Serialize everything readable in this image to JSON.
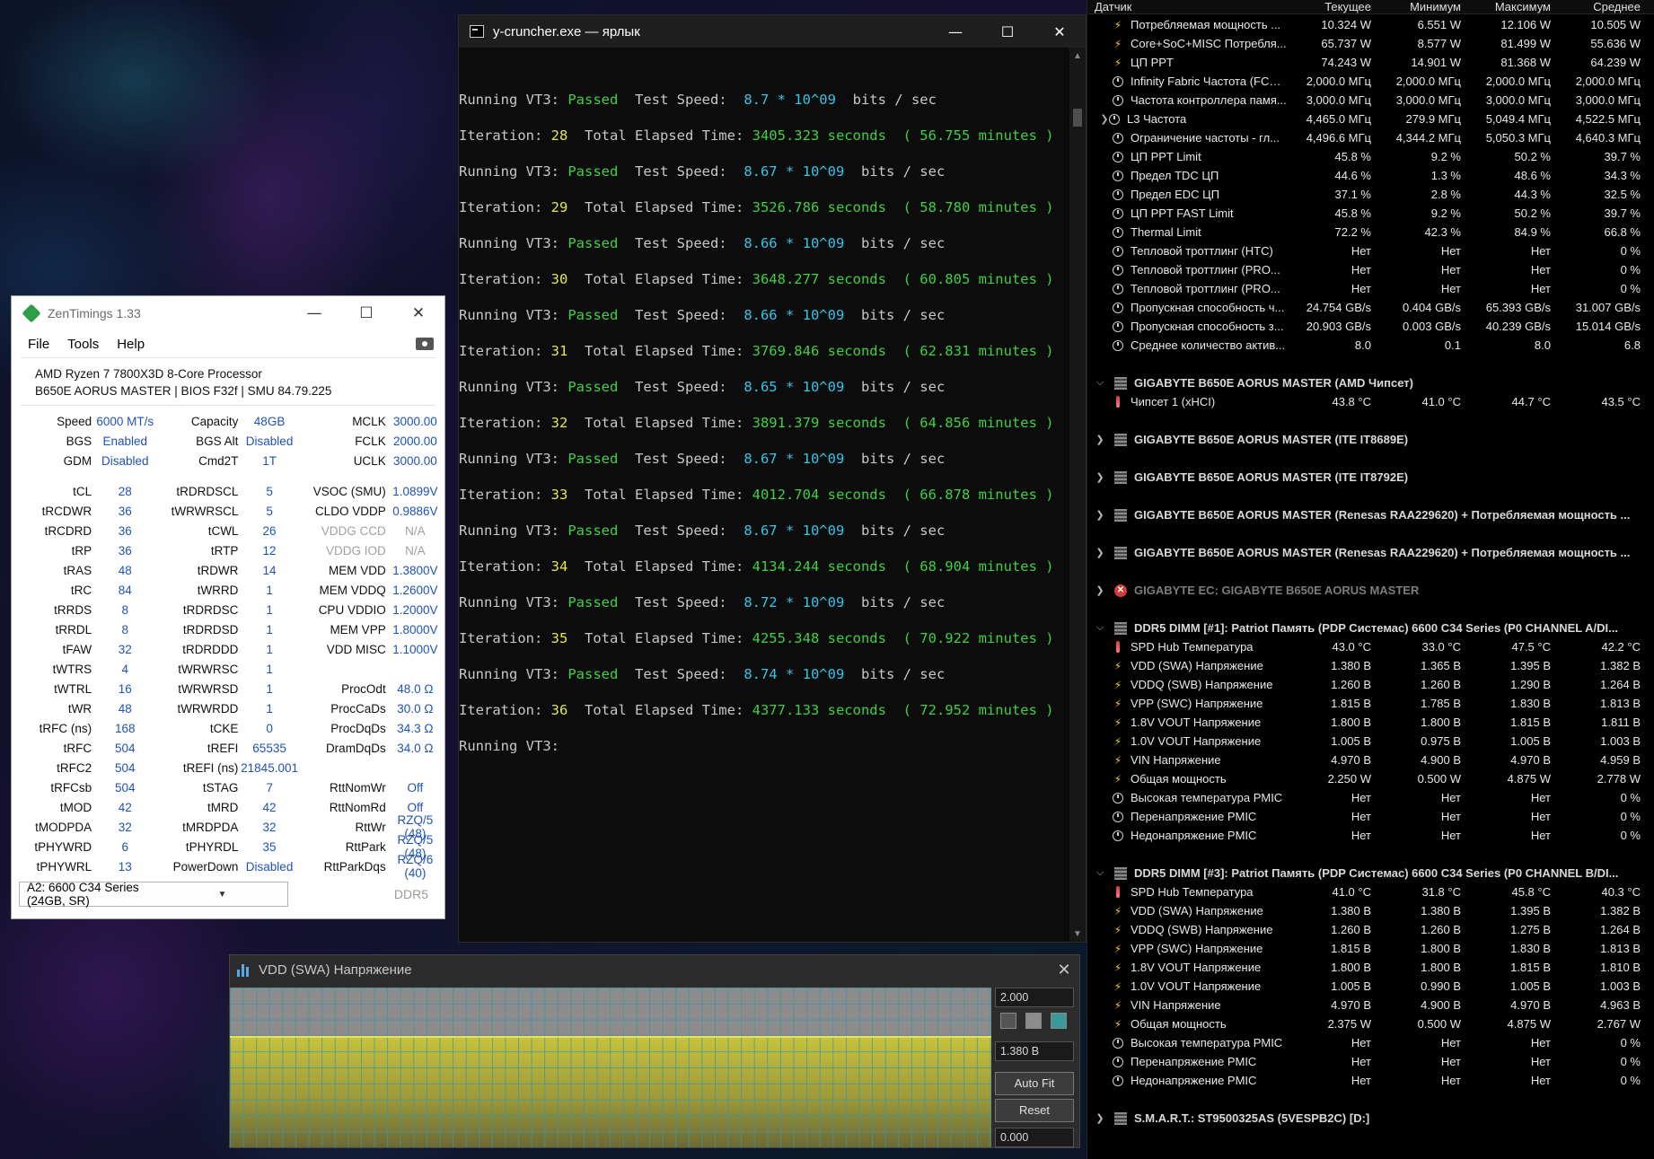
{
  "console": {
    "title": "y-cruncher.exe — ярлык",
    "lines": [
      {
        "type": "run",
        "label": "Running VT3: ",
        "status": "Passed",
        "mid": "  Test Speed:  ",
        "speed": "8.7 * 10^09",
        "unit": "  bits / sec"
      },
      {
        "type": "iter",
        "label": "Iteration: ",
        "n": "28",
        "mid": "  Total Elapsed Time: ",
        "sec": "3405.323 seconds",
        "min": "  ( 56.755 minutes )"
      },
      {
        "type": "run",
        "label": "Running VT3: ",
        "status": "Passed",
        "mid": "  Test Speed:  ",
        "speed": "8.67 * 10^09",
        "unit": "  bits / sec"
      },
      {
        "type": "iter",
        "label": "Iteration: ",
        "n": "29",
        "mid": "  Total Elapsed Time: ",
        "sec": "3526.786 seconds",
        "min": "  ( 58.780 minutes )"
      },
      {
        "type": "run",
        "label": "Running VT3: ",
        "status": "Passed",
        "mid": "  Test Speed:  ",
        "speed": "8.66 * 10^09",
        "unit": "  bits / sec"
      },
      {
        "type": "iter",
        "label": "Iteration: ",
        "n": "30",
        "mid": "  Total Elapsed Time: ",
        "sec": "3648.277 seconds",
        "min": "  ( 60.805 minutes )"
      },
      {
        "type": "run",
        "label": "Running VT3: ",
        "status": "Passed",
        "mid": "  Test Speed:  ",
        "speed": "8.66 * 10^09",
        "unit": "  bits / sec"
      },
      {
        "type": "iter",
        "label": "Iteration: ",
        "n": "31",
        "mid": "  Total Elapsed Time: ",
        "sec": "3769.846 seconds",
        "min": "  ( 62.831 minutes )"
      },
      {
        "type": "run",
        "label": "Running VT3: ",
        "status": "Passed",
        "mid": "  Test Speed:  ",
        "speed": "8.65 * 10^09",
        "unit": "  bits / sec"
      },
      {
        "type": "iter",
        "label": "Iteration: ",
        "n": "32",
        "mid": "  Total Elapsed Time: ",
        "sec": "3891.379 seconds",
        "min": "  ( 64.856 minutes )"
      },
      {
        "type": "run",
        "label": "Running VT3: ",
        "status": "Passed",
        "mid": "  Test Speed:  ",
        "speed": "8.67 * 10^09",
        "unit": "  bits / sec"
      },
      {
        "type": "iter",
        "label": "Iteration: ",
        "n": "33",
        "mid": "  Total Elapsed Time: ",
        "sec": "4012.704 seconds",
        "min": "  ( 66.878 minutes )"
      },
      {
        "type": "run",
        "label": "Running VT3: ",
        "status": "Passed",
        "mid": "  Test Speed:  ",
        "speed": "8.67 * 10^09",
        "unit": "  bits / sec"
      },
      {
        "type": "iter",
        "label": "Iteration: ",
        "n": "34",
        "mid": "  Total Elapsed Time: ",
        "sec": "4134.244 seconds",
        "min": "  ( 68.904 minutes )"
      },
      {
        "type": "run",
        "label": "Running VT3: ",
        "status": "Passed",
        "mid": "  Test Speed:  ",
        "speed": "8.72 * 10^09",
        "unit": "  bits / sec"
      },
      {
        "type": "iter",
        "label": "Iteration: ",
        "n": "35",
        "mid": "  Total Elapsed Time: ",
        "sec": "4255.348 seconds",
        "min": "  ( 70.922 minutes )"
      },
      {
        "type": "run",
        "label": "Running VT3: ",
        "status": "Passed",
        "mid": "  Test Speed:  ",
        "speed": "8.74 * 10^09",
        "unit": "  bits / sec"
      },
      {
        "type": "iter",
        "label": "Iteration: ",
        "n": "36",
        "mid": "  Total Elapsed Time: ",
        "sec": "4377.133 seconds",
        "min": "  ( 72.952 minutes )"
      },
      {
        "type": "plain",
        "text": "Running VT3:"
      }
    ]
  },
  "zen": {
    "title": "ZenTimings 1.33",
    "menu": [
      "File",
      "Tools",
      "Help"
    ],
    "cpu": "AMD Ryzen 7 7800X3D 8-Core Processor",
    "board": "B650E AORUS MASTER | BIOS F32f | SMU 84.79.225",
    "rows": [
      [
        [
          "Speed",
          "6000 MT/s"
        ],
        [
          "Capacity",
          "48GB"
        ],
        [
          "MCLK",
          "3000.00"
        ]
      ],
      [
        [
          "BGS",
          "Enabled"
        ],
        [
          "BGS Alt",
          "Disabled"
        ],
        [
          "FCLK",
          "2000.00"
        ]
      ],
      [
        [
          "GDM",
          "Disabled"
        ],
        [
          "Cmd2T",
          "1T"
        ],
        [
          "UCLK",
          "3000.00"
        ]
      ],
      "gap",
      [
        [
          "tCL",
          "28"
        ],
        [
          "tRDRDSCL",
          "5"
        ],
        [
          "VSOC (SMU)",
          "1.0899V"
        ]
      ],
      [
        [
          "tRCDWR",
          "36"
        ],
        [
          "tWRWRSCL",
          "5"
        ],
        [
          "CLDO VDDP",
          "0.9886V"
        ]
      ],
      [
        [
          "tRCDRD",
          "36"
        ],
        [
          "tCWL",
          "26"
        ],
        [
          "VDDG CCD",
          "N/A",
          "dim"
        ]
      ],
      [
        [
          "tRP",
          "36"
        ],
        [
          "tRTP",
          "12"
        ],
        [
          "VDDG IOD",
          "N/A",
          "dim"
        ]
      ],
      [
        [
          "tRAS",
          "48"
        ],
        [
          "tRDWR",
          "14"
        ],
        [
          "MEM VDD",
          "1.3800V"
        ]
      ],
      [
        [
          "tRC",
          "84"
        ],
        [
          "tWRRD",
          "1"
        ],
        [
          "MEM VDDQ",
          "1.2600V"
        ]
      ],
      [
        [
          "tRRDS",
          "8"
        ],
        [
          "tRDRDSC",
          "1"
        ],
        [
          "CPU VDDIO",
          "1.2000V"
        ]
      ],
      [
        [
          "tRRDL",
          "8"
        ],
        [
          "tRDRDSD",
          "1"
        ],
        [
          "MEM VPP",
          "1.8000V"
        ]
      ],
      [
        [
          "tFAW",
          "32"
        ],
        [
          "tRDRDDD",
          "1"
        ],
        [
          "VDD MISC",
          "1.1000V"
        ]
      ],
      [
        [
          "tWTRS",
          "4"
        ],
        [
          "tWRWRSC",
          "1"
        ],
        [
          "",
          ""
        ]
      ],
      [
        [
          "tWTRL",
          "16"
        ],
        [
          "tWRWRSD",
          "1"
        ],
        [
          "ProcOdt",
          "48.0 Ω"
        ]
      ],
      [
        [
          "tWR",
          "48"
        ],
        [
          "tWRWRDD",
          "1"
        ],
        [
          "ProcCaDs",
          "30.0 Ω"
        ]
      ],
      [
        [
          "tRFC (ns)",
          "168"
        ],
        [
          "tCKE",
          "0"
        ],
        [
          "ProcDqDs",
          "34.3 Ω"
        ]
      ],
      [
        [
          "tRFC",
          "504"
        ],
        [
          "tREFI",
          "65535"
        ],
        [
          "DramDqDs",
          "34.0 Ω"
        ]
      ],
      [
        [
          "tRFC2",
          "504"
        ],
        [
          "tREFI (ns)",
          "21845.001"
        ],
        [
          "",
          ""
        ]
      ],
      [
        [
          "tRFCsb",
          "504"
        ],
        [
          "tSTAG",
          "7"
        ],
        [
          "RttNomWr",
          "Off"
        ]
      ],
      [
        [
          "tMOD",
          "42"
        ],
        [
          "tMRD",
          "42"
        ],
        [
          "RttNomRd",
          "Off"
        ]
      ],
      [
        [
          "tMODPDA",
          "32"
        ],
        [
          "tMRDPDA",
          "32"
        ],
        [
          "RttWr",
          "RZQ/5 (48)"
        ]
      ],
      [
        [
          "tPHYWRD",
          "6"
        ],
        [
          "tPHYRDL",
          "35"
        ],
        [
          "RttPark",
          "RZQ/5 (48)"
        ]
      ],
      [
        [
          "tPHYWRL",
          "13"
        ],
        [
          "PowerDown",
          "Disabled"
        ],
        [
          "RttParkDqs",
          "RZQ/6 (40)"
        ]
      ]
    ],
    "module_select": "A2: 6600 C34 Series (24GB, SR)",
    "ddr": "DDR5"
  },
  "graph": {
    "title": "VDD (SWA) Напряжение",
    "max": "2.000",
    "current": "1.380 В",
    "min": "0.000",
    "value_fraction": 0.69,
    "autofit": "Auto Fit",
    "reset": "Reset",
    "swatches": [
      "#555555",
      "#8c8c8c",
      "#3a9a9a"
    ],
    "colors": {
      "fill": "#c7c23d",
      "line": "#e7e25a",
      "grid": "#3c96a0"
    }
  },
  "sensors": {
    "columns": [
      "Датчик",
      "Текущее",
      "Минимум",
      "Максимум",
      "Среднее"
    ],
    "items": [
      {
        "k": "row",
        "icon": "bolt",
        "name": "Потребляемая мощность ...",
        "v": [
          "10.324 W",
          "6.551 W",
          "12.106 W",
          "10.505 W"
        ]
      },
      {
        "k": "row",
        "icon": "bolt",
        "name": "Core+SoC+MISC Потребля...",
        "v": [
          "65.737 W",
          "8.577 W",
          "81.499 W",
          "55.636 W"
        ]
      },
      {
        "k": "row",
        "icon": "bolt",
        "name": "ЦП PPT",
        "v": [
          "74.243 W",
          "14.901 W",
          "81.368 W",
          "64.239 W"
        ]
      },
      {
        "k": "row",
        "icon": "clock",
        "name": "Infinity Fabric Частота (FCLK)",
        "v": [
          "2,000.0 МГц",
          "2,000.0 МГц",
          "2,000.0 МГц",
          "2,000.0 МГц"
        ]
      },
      {
        "k": "row",
        "icon": "clock",
        "name": "Частота контроллера памя...",
        "v": [
          "3,000.0 МГц",
          "3,000.0 МГц",
          "3,000.0 МГц",
          "3,000.0 МГц"
        ]
      },
      {
        "k": "row",
        "icon": "clock",
        "exp": true,
        "name": "L3 Частота",
        "v": [
          "4,465.0 МГц",
          "279.9 МГц",
          "5,049.4 МГц",
          "4,522.5 МГц"
        ]
      },
      {
        "k": "row",
        "icon": "clock",
        "name": "Ограничение частоты - гл...",
        "v": [
          "4,496.6 МГц",
          "4,344.2 МГц",
          "5,050.3 МГц",
          "4,640.3 МГц"
        ]
      },
      {
        "k": "row",
        "icon": "clock",
        "name": "ЦП PPT Limit",
        "v": [
          "45.8 %",
          "9.2 %",
          "50.2 %",
          "39.7 %"
        ]
      },
      {
        "k": "row",
        "icon": "clock",
        "name": "Предел TDC ЦП",
        "v": [
          "44.6 %",
          "1.3 %",
          "48.6 %",
          "34.3 %"
        ]
      },
      {
        "k": "row",
        "icon": "clock",
        "name": "Предел EDC ЦП",
        "v": [
          "37.1 %",
          "2.8 %",
          "44.3 %",
          "32.5 %"
        ]
      },
      {
        "k": "row",
        "icon": "clock",
        "name": "ЦП PPT FAST Limit",
        "v": [
          "45.8 %",
          "9.2 %",
          "50.2 %",
          "39.7 %"
        ]
      },
      {
        "k": "row",
        "icon": "clock",
        "name": "Thermal Limit",
        "v": [
          "72.2 %",
          "42.3 %",
          "84.9 %",
          "66.8 %"
        ]
      },
      {
        "k": "row",
        "icon": "clock",
        "name": "Тепловой троттлинг (HTC)",
        "v": [
          "Нет",
          "Нет",
          "Нет",
          "0 %"
        ]
      },
      {
        "k": "row",
        "icon": "clock",
        "name": "Тепловой троттлинг (PRO...",
        "v": [
          "Нет",
          "Нет",
          "Нет",
          "0 %"
        ]
      },
      {
        "k": "row",
        "icon": "clock",
        "name": "Тепловой троттлинг (PRO...",
        "v": [
          "Нет",
          "Нет",
          "Нет",
          "0 %"
        ]
      },
      {
        "k": "row",
        "icon": "clock",
        "name": "Пропускная способность ч...",
        "v": [
          "24.754 GB/s",
          "0.404 GB/s",
          "65.393 GB/s",
          "31.007 GB/s"
        ]
      },
      {
        "k": "row",
        "icon": "clock",
        "name": "Пропускная способность з...",
        "v": [
          "20.903 GB/s",
          "0.003 GB/s",
          "40.239 GB/s",
          "15.014 GB/s"
        ]
      },
      {
        "k": "row",
        "icon": "clock",
        "name": "Среднее количество актив...",
        "v": [
          "8.0",
          "0.1",
          "8.0",
          "6.8"
        ]
      },
      {
        "k": "spacer"
      },
      {
        "k": "group",
        "arrow": "open",
        "name": "GIGABYTE B650E AORUS MASTER (AMD Чипсет)"
      },
      {
        "k": "row",
        "icon": "thermo",
        "name": "Чипсет 1 (xHCI)",
        "v": [
          "43.8 °C",
          "41.0 °C",
          "44.7 °C",
          "43.5 °C"
        ]
      },
      {
        "k": "spacer"
      },
      {
        "k": "group",
        "arrow": "closed",
        "name": "GIGABYTE B650E AORUS MASTER (ITE IT8689E)"
      },
      {
        "k": "spacer"
      },
      {
        "k": "group",
        "arrow": "closed",
        "name": "GIGABYTE B650E AORUS MASTER (ITE IT8792E)"
      },
      {
        "k": "spacer"
      },
      {
        "k": "group",
        "arrow": "closed",
        "name": "GIGABYTE B650E AORUS MASTER (Renesas RAA229620) + Потребляемая мощность ..."
      },
      {
        "k": "spacer"
      },
      {
        "k": "group",
        "arrow": "closed",
        "name": "GIGABYTE B650E AORUS MASTER (Renesas RAA229620) + Потребляемая мощность ..."
      },
      {
        "k": "spacer"
      },
      {
        "k": "group",
        "arrow": "closed",
        "err": true,
        "dim": true,
        "name": "GIGABYTE EC: GIGABYTE B650E AORUS MASTER"
      },
      {
        "k": "spacer"
      },
      {
        "k": "group",
        "arrow": "open",
        "name": "DDR5 DIMM [#1]: Patriot Память (PDP Системас) 6600 C34 Series (P0 CHANNEL A/DI..."
      },
      {
        "k": "row",
        "icon": "thermo",
        "name": "SPD Hub Температура",
        "v": [
          "43.0 °C",
          "33.0 °C",
          "47.5 °C",
          "42.2 °C"
        ]
      },
      {
        "k": "row",
        "icon": "bolt",
        "name": "VDD (SWA) Напряжение",
        "v": [
          "1.380 В",
          "1.365 В",
          "1.395 В",
          "1.382 В"
        ]
      },
      {
        "k": "row",
        "icon": "bolt",
        "name": "VDDQ (SWB) Напряжение",
        "v": [
          "1.260 В",
          "1.260 В",
          "1.290 В",
          "1.264 В"
        ]
      },
      {
        "k": "row",
        "icon": "bolt",
        "name": "VPP (SWC) Напряжение",
        "v": [
          "1.815 В",
          "1.785 В",
          "1.830 В",
          "1.813 В"
        ]
      },
      {
        "k": "row",
        "icon": "bolt",
        "name": "1.8V VOUT Напряжение",
        "v": [
          "1.800 В",
          "1.800 В",
          "1.815 В",
          "1.811 В"
        ]
      },
      {
        "k": "row",
        "icon": "bolt",
        "name": "1.0V VOUT Напряжение",
        "v": [
          "1.005 В",
          "0.975 В",
          "1.005 В",
          "1.003 В"
        ]
      },
      {
        "k": "row",
        "icon": "bolt",
        "name": "VIN Напряжение",
        "v": [
          "4.970 В",
          "4.900 В",
          "4.970 В",
          "4.959 В"
        ]
      },
      {
        "k": "row",
        "icon": "bolt",
        "name": "Общая мощность",
        "v": [
          "2.250 W",
          "0.500 W",
          "4.875 W",
          "2.778 W"
        ]
      },
      {
        "k": "row",
        "icon": "clock",
        "name": "Высокая температура PMIC",
        "v": [
          "Нет",
          "Нет",
          "Нет",
          "0 %"
        ]
      },
      {
        "k": "row",
        "icon": "clock",
        "name": "Перенапряжение PMIC",
        "v": [
          "Нет",
          "Нет",
          "Нет",
          "0 %"
        ]
      },
      {
        "k": "row",
        "icon": "clock",
        "name": "Недонапряжение PMIC",
        "v": [
          "Нет",
          "Нет",
          "Нет",
          "0 %"
        ]
      },
      {
        "k": "spacer"
      },
      {
        "k": "group",
        "arrow": "open",
        "name": "DDR5 DIMM [#3]: Patriot Память (PDP Системас) 6600 C34 Series (P0 CHANNEL B/DI..."
      },
      {
        "k": "row",
        "icon": "thermo",
        "name": "SPD Hub Температура",
        "v": [
          "41.0 °C",
          "31.8 °C",
          "45.8 °C",
          "40.3 °C"
        ]
      },
      {
        "k": "row",
        "icon": "bolt",
        "name": "VDD (SWA) Напряжение",
        "v": [
          "1.380 В",
          "1.380 В",
          "1.395 В",
          "1.382 В"
        ]
      },
      {
        "k": "row",
        "icon": "bolt",
        "name": "VDDQ (SWB) Напряжение",
        "v": [
          "1.260 В",
          "1.260 В",
          "1.275 В",
          "1.264 В"
        ]
      },
      {
        "k": "row",
        "icon": "bolt",
        "name": "VPP (SWC) Напряжение",
        "v": [
          "1.815 В",
          "1.800 В",
          "1.830 В",
          "1.813 В"
        ]
      },
      {
        "k": "row",
        "icon": "bolt",
        "name": "1.8V VOUT Напряжение",
        "v": [
          "1.800 В",
          "1.800 В",
          "1.815 В",
          "1.810 В"
        ]
      },
      {
        "k": "row",
        "icon": "bolt",
        "name": "1.0V VOUT Напряжение",
        "v": [
          "1.005 В",
          "0.990 В",
          "1.005 В",
          "1.003 В"
        ]
      },
      {
        "k": "row",
        "icon": "bolt",
        "name": "VIN Напряжение",
        "v": [
          "4.970 В",
          "4.900 В",
          "4.970 В",
          "4.963 В"
        ]
      },
      {
        "k": "row",
        "icon": "bolt",
        "name": "Общая мощность",
        "v": [
          "2.375 W",
          "0.500 W",
          "4.875 W",
          "2.767 W"
        ]
      },
      {
        "k": "row",
        "icon": "clock",
        "name": "Высокая температура PMIC",
        "v": [
          "Нет",
          "Нет",
          "Нет",
          "0 %"
        ]
      },
      {
        "k": "row",
        "icon": "clock",
        "name": "Перенапряжение PMIC",
        "v": [
          "Нет",
          "Нет",
          "Нет",
          "0 %"
        ]
      },
      {
        "k": "row",
        "icon": "clock",
        "name": "Недонапряжение PMIC",
        "v": [
          "Нет",
          "Нет",
          "Нет",
          "0 %"
        ]
      },
      {
        "k": "spacer"
      },
      {
        "k": "group",
        "arrow": "closed",
        "name": "S.M.A.R.T.: ST9500325AS (5VESPB2C) [D:]"
      }
    ]
  }
}
